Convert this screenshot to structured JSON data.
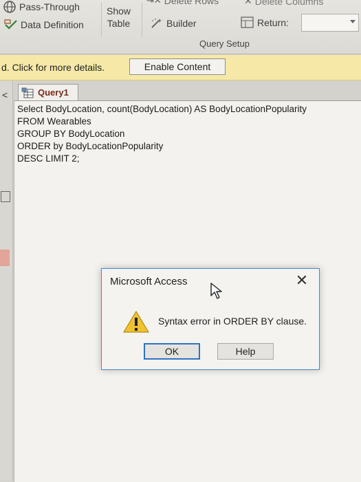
{
  "ribbon": {
    "pass_through": "Pass-Through",
    "data_definition": "Data Definition",
    "show_table_line1": "Show",
    "show_table_line2": "Table",
    "delete_rows": "Delete Rows",
    "delete_columns": "Delete Columns",
    "builder": "Builder",
    "return_label": "Return:",
    "return_value": "",
    "group_label": "Query Setup"
  },
  "security_bar": {
    "message": "d. Click for more details.",
    "enable_button": "Enable Content"
  },
  "document": {
    "tab_title": "Query1",
    "sql_lines": [
      "Select BodyLocation, count(BodyLocation) AS BodyLocationPopularity",
      "FROM Wearables",
      "GROUP BY  BodyLocation",
      "ORDER by BodyLocationPopularity",
      "DESC LIMIT 2;"
    ]
  },
  "dialog": {
    "title": "Microsoft Access",
    "message": "Syntax error in ORDER BY clause.",
    "ok_button": "OK",
    "help_button": "Help",
    "close_glyph": "✕"
  },
  "nav": {
    "collapse_glyph": "<"
  }
}
